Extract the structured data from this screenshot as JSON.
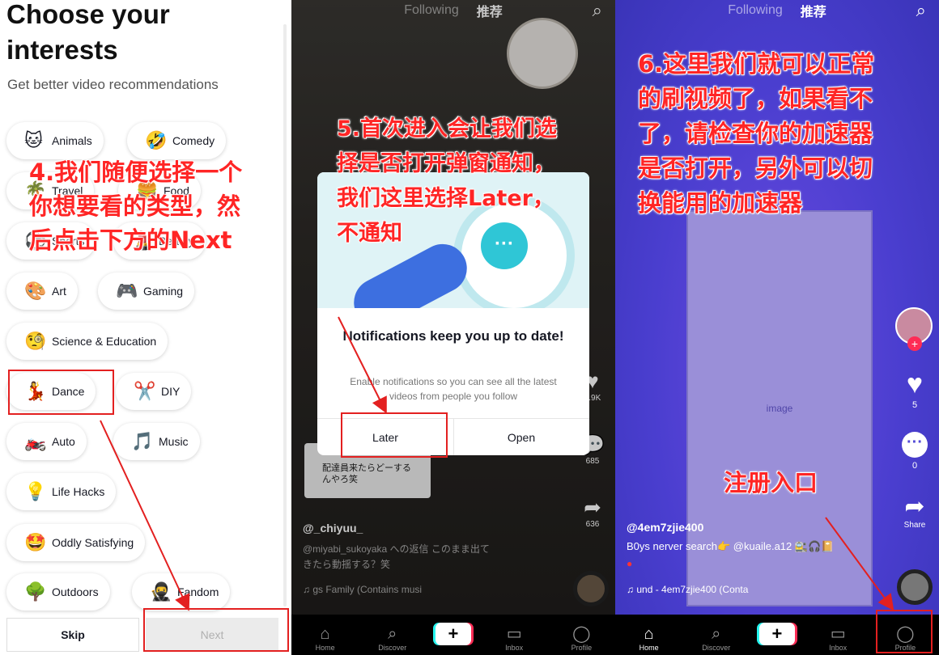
{
  "panel1": {
    "title_line1": "Choose your",
    "title_line2": "interests",
    "subtitle": "Get better video recommendations",
    "interests": [
      {
        "icon": "cat-face-icon",
        "glyph": "🐱",
        "label": "Animals"
      },
      {
        "icon": "laughing-face-icon",
        "glyph": "🤣",
        "label": "Comedy"
      },
      {
        "icon": "travel-icon",
        "glyph": "🌴",
        "label": "Travel"
      },
      {
        "icon": "food-icon",
        "glyph": "🍔",
        "label": "Food"
      },
      {
        "icon": "sports-icon",
        "glyph": "⚽",
        "label": "Sports"
      },
      {
        "icon": "beauty-icon",
        "glyph": "💄",
        "label": "Beauty"
      },
      {
        "icon": "palette-icon",
        "glyph": "🎨",
        "label": "Art"
      },
      {
        "icon": "game-controller-icon",
        "glyph": "🎮",
        "label": "Gaming"
      },
      {
        "icon": "monocle-face-icon",
        "glyph": "🧐",
        "label": "Science & Education"
      },
      {
        "icon": "dancer-icon",
        "glyph": "💃",
        "label": "Dance"
      },
      {
        "icon": "scissors-icon",
        "glyph": "✂️",
        "label": "DIY"
      },
      {
        "icon": "motorcycle-icon",
        "glyph": "🏍️",
        "label": "Auto"
      },
      {
        "icon": "music-note-icon",
        "glyph": "🎵",
        "label": "Music"
      },
      {
        "icon": "light-bulb-icon",
        "glyph": "💡",
        "label": "Life Hacks"
      },
      {
        "icon": "star-struck-face-icon",
        "glyph": "🤩",
        "label": "Oddly Satisfying"
      },
      {
        "icon": "tree-icon",
        "glyph": "🌳",
        "label": "Outdoors"
      },
      {
        "icon": "ninja-icon",
        "glyph": "🥷",
        "label": "Fandom"
      }
    ],
    "skip_label": "Skip",
    "next_label": "Next",
    "annotation": "4.我们随便选择一个\n你想要看的类型，然\n后点击下方的Next"
  },
  "panel2": {
    "nav_following": "Following",
    "nav_foryou": "推荐",
    "dialog_title": "Notifications keep you up to date!",
    "dialog_body": "Enable notifications so you can see all the latest videos from people you follow",
    "later_label": "Later",
    "open_label": "Open",
    "comment_text": "配達員来たらどーする\nんやろ笑",
    "username": "@_chiyuu_",
    "caption": "@miyabi_sukoyaka への返信 このまま出て\nきたら動揺する？笑",
    "music": "gs Family (Contains musi",
    "like_count": "3.9K",
    "comment_count": "685",
    "share_count": "636",
    "annotation": "5.首次进入会让我们选\n择是否打开弹窗通知，\n我们这里选择Later，\n不通知"
  },
  "panel3": {
    "nav_following": "Following",
    "nav_foryou": "推荐",
    "username": "@4em7zjie400",
    "caption": "B0ys nerver search👉 @kuaile.a12 🚉🎧📔",
    "music": "und - 4em7zjie400 (Conta",
    "like_count": "5",
    "comment_count": "0",
    "share_label": "Share",
    "annotation_main": "6.这里我们就可以正常\n的刷视频了，如果看不\n了，请检查你的加速器\n是否打开，另外可以切\n换能用的加速器",
    "annotation_register": "注册入口"
  },
  "bottom_nav": {
    "home": "Home",
    "discover": "Discover",
    "inbox": "Inbox",
    "profile": "Profile"
  },
  "colors": {
    "annotation_red": "#ff2525",
    "tiktok_cyan": "#25f4ee",
    "tiktok_red": "#fe2c55",
    "dialog_teal": "#2fc6d6"
  }
}
